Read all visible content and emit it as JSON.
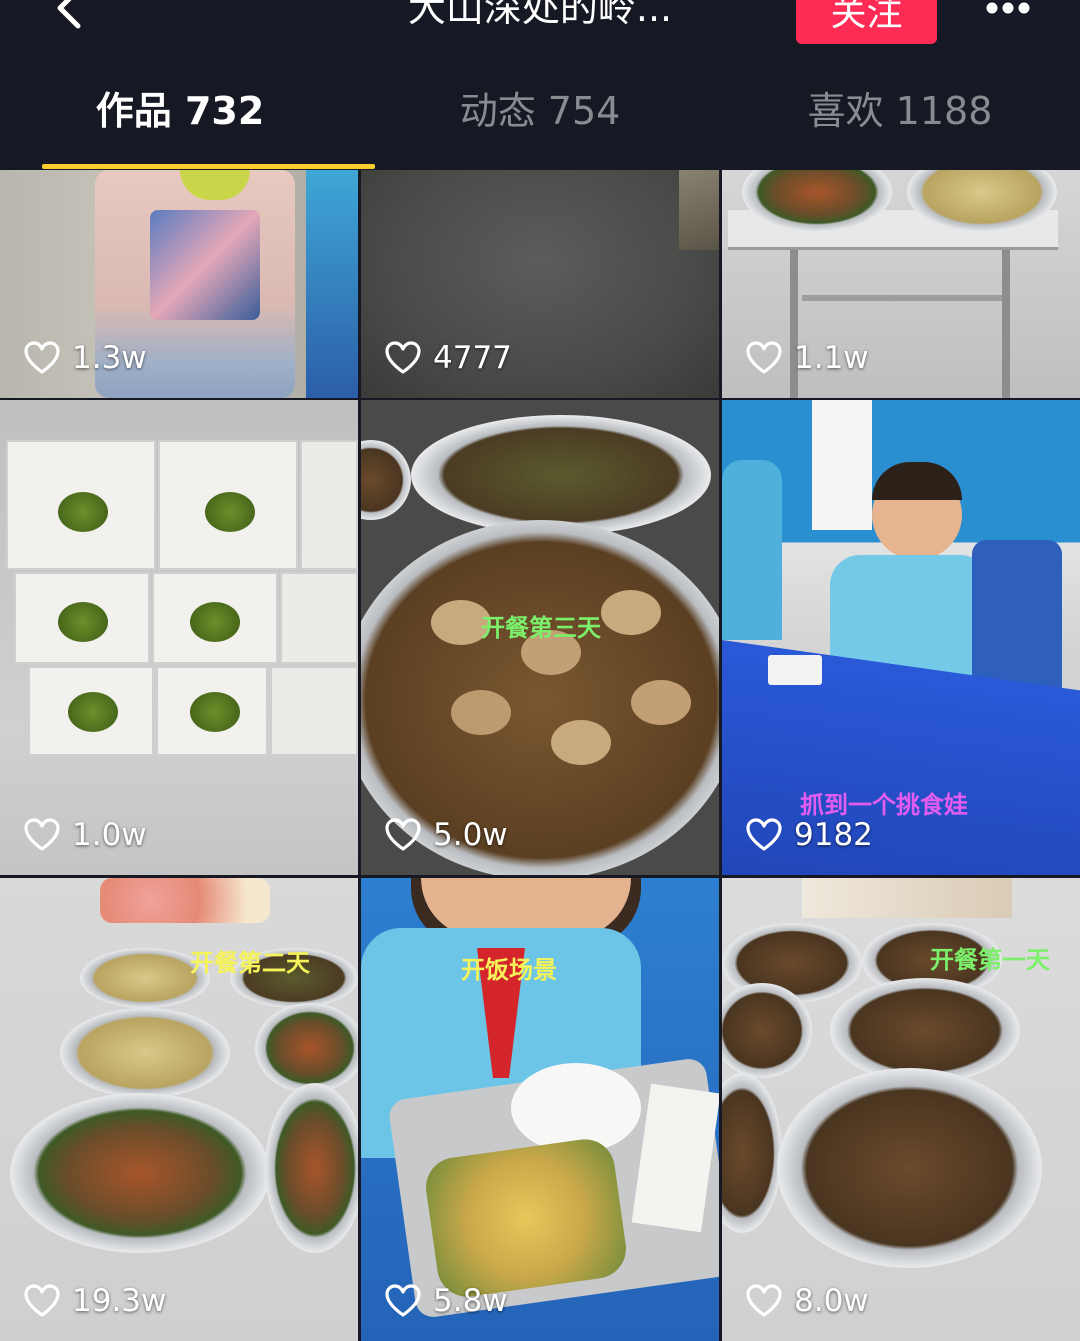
{
  "header": {
    "title": "大山深处的岭...",
    "follow_label": "关注",
    "back_icon": "chevron-left-icon",
    "more_icon": "more-dots-icon"
  },
  "tabs": [
    {
      "label": "作品 732",
      "active": true
    },
    {
      "label": "动态 754",
      "active": false
    },
    {
      "label": "喜欢 1188",
      "active": false
    }
  ],
  "colors": {
    "background": "#161823",
    "follow_button": "#fe2c55",
    "tab_indicator": "#facd2d",
    "tab_inactive": "#8a8b91"
  },
  "videos": [
    {
      "likes": "1.3w",
      "overlay": ""
    },
    {
      "likes": "4777",
      "overlay": ""
    },
    {
      "likes": "1.1w",
      "overlay": ""
    },
    {
      "likes": "1.0w",
      "overlay": ""
    },
    {
      "likes": "5.0w",
      "overlay": "开餐第三天"
    },
    {
      "likes": "9182",
      "overlay": "抓到一个挑食娃"
    },
    {
      "likes": "19.3w",
      "overlay": "开餐第二天"
    },
    {
      "likes": "5.8w",
      "overlay": "开饭场景"
    },
    {
      "likes": "8.0w",
      "overlay": "开餐第一天"
    }
  ]
}
